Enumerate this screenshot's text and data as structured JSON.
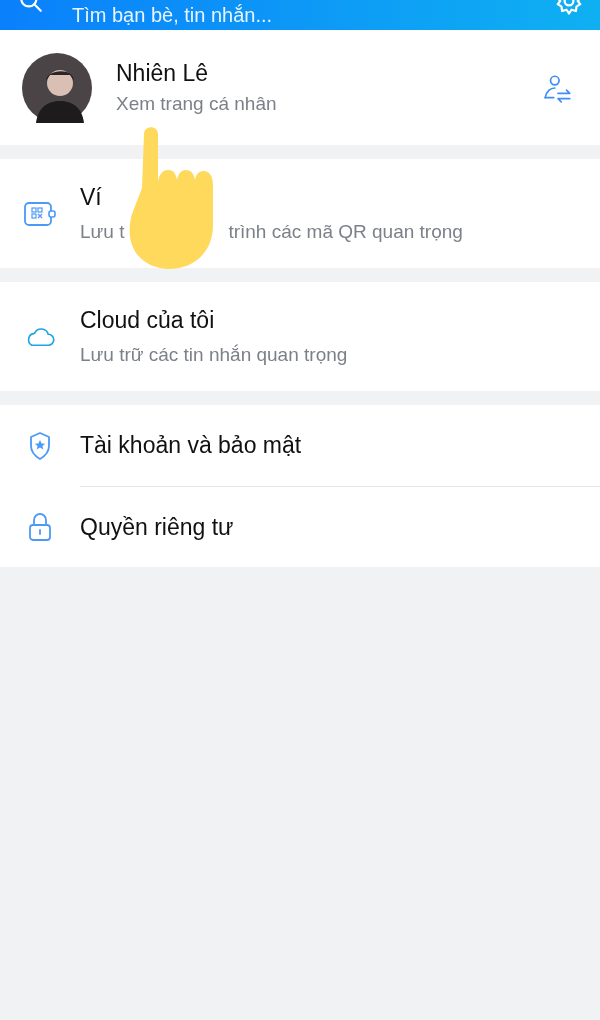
{
  "header": {
    "search_placeholder": "Tìm bạn bè, tin nhắn..."
  },
  "profile": {
    "name": "Nhiên Lê",
    "subtitle": "Xem trang cá nhân"
  },
  "groups": [
    {
      "items": [
        {
          "title": "Ví",
          "subtitle_parts": [
            "Lưu t",
            "trình các mã QR quan trọng"
          ]
        }
      ]
    },
    {
      "items": [
        {
          "title": "Cloud của tôi",
          "subtitle_parts": [
            "Lưu trữ các tin nhắn quan trọng"
          ]
        }
      ]
    },
    {
      "items": [
        {
          "title": "Tài khoản và bảo mật"
        },
        {
          "title": "Quyền riêng tư"
        }
      ]
    }
  ]
}
